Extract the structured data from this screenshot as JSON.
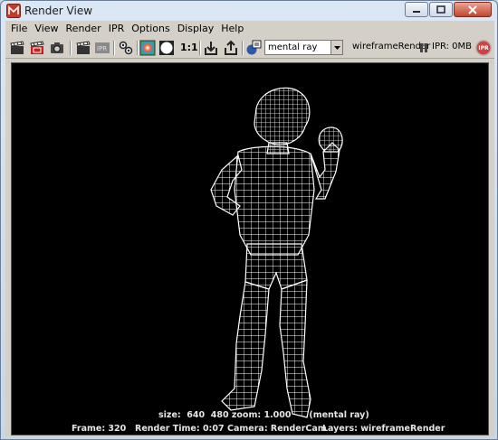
{
  "window": {
    "title": "Render View",
    "app_icon": "maya-app-icon",
    "controls": [
      "minimize-icon",
      "maximize-icon",
      "close-icon"
    ]
  },
  "menubar": {
    "items": [
      "File",
      "View",
      "Render",
      "IPR",
      "Options",
      "Display",
      "Help"
    ]
  },
  "toolbar": {
    "icons": [
      "redo-render-icon",
      "redo-region-icon",
      "snapshot-icon",
      "render-region-icon",
      "ipr-render-icon",
      "render-settings-icon",
      "color-display-icon",
      "alpha-display-icon",
      "keep-image-icon",
      "remove-image-icon",
      "display-settings-icon"
    ],
    "ratio_label": "1:1",
    "renderer": "mental ray",
    "layer_label": "wireframeRender",
    "ipr_memory": "IPR: 0MB",
    "ipr_badge": "IPR"
  },
  "viewport": {
    "info_line": "size:  640  480 zoom: 1.000      (mental ray)",
    "frame": "Frame: 320",
    "render_time": "Render Time: 0:07",
    "camera": "Camera: RenderCam",
    "layers": "Layers: wireframeRender",
    "background": "#000000",
    "wire_color": "#ffffff"
  }
}
